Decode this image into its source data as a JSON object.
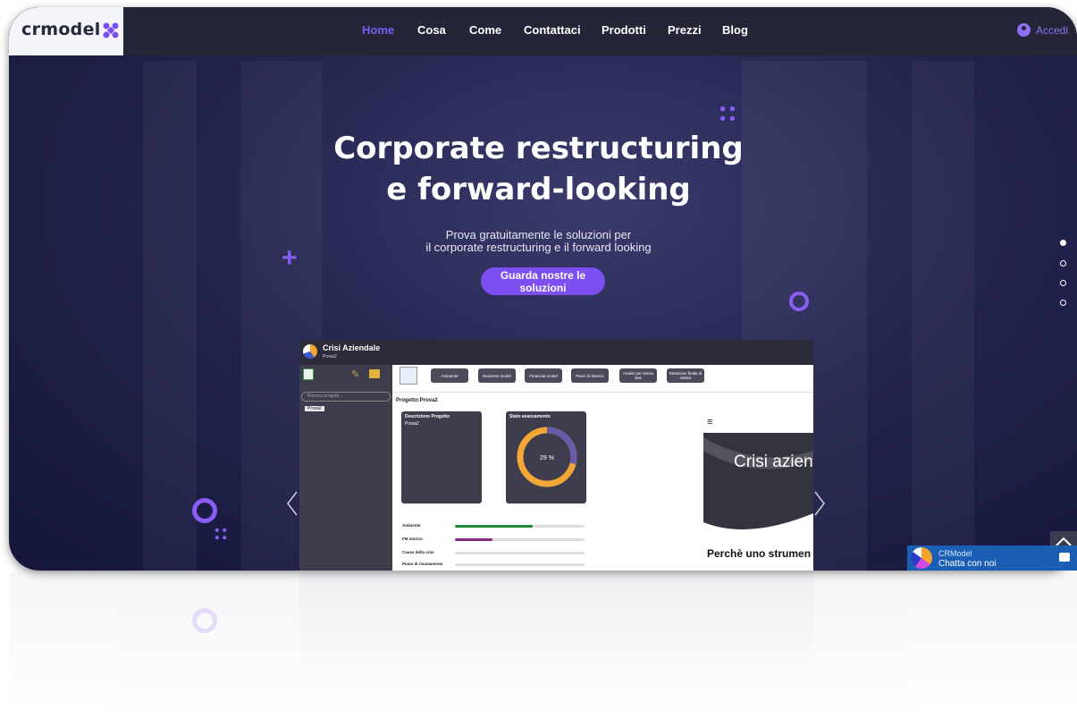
{
  "brand": {
    "logo_text": "crmodel",
    "accent": "#7c4ff0"
  },
  "nav": {
    "items": [
      "Home",
      "Cosa",
      "Come",
      "Contattaci",
      "Prodotti",
      "Prezzi",
      "Blog"
    ],
    "active": "Home",
    "login_label": "Accedi"
  },
  "hero": {
    "title_line1": "Corporate restructuring",
    "title_line2": "e forward-looking",
    "subtitle_line1": "Prova gratuitamente le soluzioni per",
    "subtitle_line2": "il corporate restructuring e il forward looking",
    "cta_label": "Guarda nostre le soluzioni"
  },
  "slider": {
    "dot_count": 4,
    "active_index": 0,
    "prev_icon": "chevron-left-icon",
    "next_icon": "chevron-right-icon"
  },
  "app_preview": {
    "title": "Crisi Aziendale",
    "subtitle": "Prova2",
    "search_placeholder": "Ricerca progetti...",
    "project_item": "Prova2",
    "toolbar_buttons": [
      "Ambiente",
      "Business model",
      "Financial model",
      "Piano di rilancio",
      "Analisi per stress test",
      "Relazione finale di sintesi"
    ],
    "project_label": "Progetto:Prova2",
    "card_description_title": "Descrizione Progetto",
    "card_description_text": "Prova2",
    "card_progress_title": "Stato avanzamento",
    "progress_percent": 29,
    "progress_label": "29 %",
    "bars": [
      {
        "label": "Ambiente",
        "fill": 0.6,
        "color": "#1e8a3a"
      },
      {
        "label": "FM storico",
        "fill": 0.29,
        "color": "#8a2a80"
      },
      {
        "label": "Cause della crisi",
        "fill": 0,
        "color": "#cccccc"
      },
      {
        "label": "Piano di risanamento",
        "fill": 0,
        "color": "#cccccc"
      }
    ],
    "slide_title": "Crisi azien",
    "slide_bottom_text": "Perchè uno strumen"
  },
  "chat": {
    "name": "CRModel",
    "message": "Chatta con noi"
  }
}
